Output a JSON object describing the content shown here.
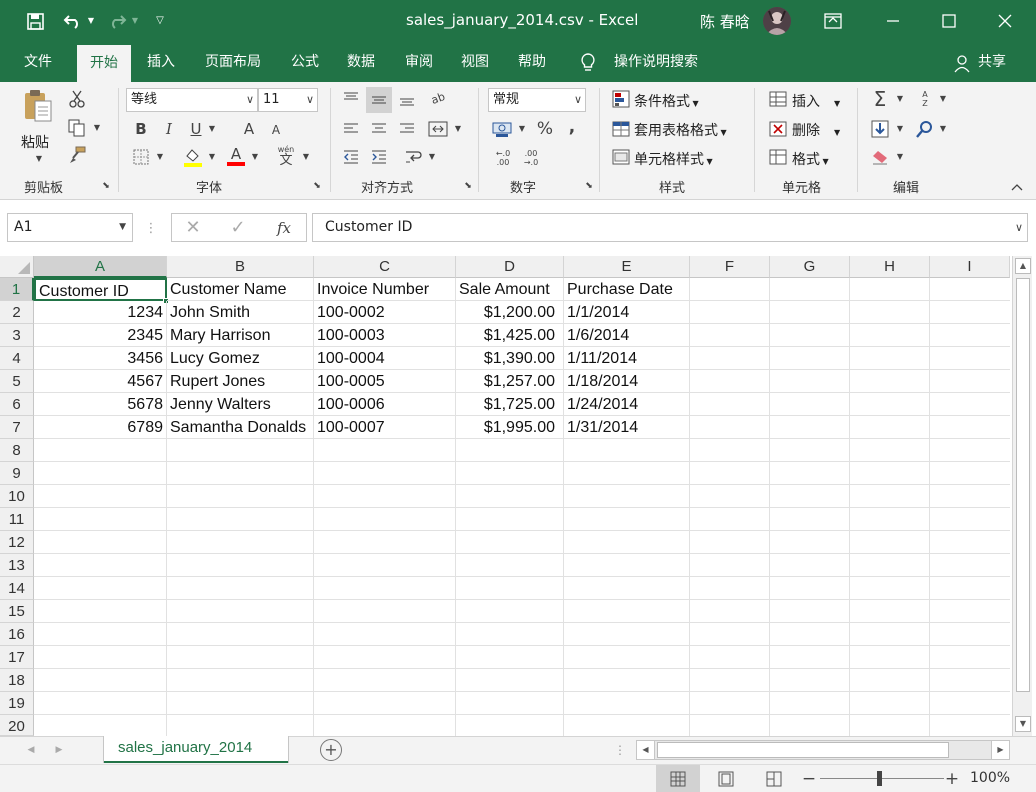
{
  "title_bar": {
    "doc_title": "sales_january_2014.csv",
    "separator": " - ",
    "app_name": "Excel",
    "user_name": "陈 春晗"
  },
  "ribbon_tabs": [
    "文件",
    "开始",
    "插入",
    "页面布局",
    "公式",
    "数据",
    "审阅",
    "视图",
    "帮助"
  ],
  "active_tab": "开始",
  "tell_me": "操作说明搜索",
  "share_label": "共享",
  "clipboard": {
    "paste_label": "粘贴",
    "group_label": "剪贴板"
  },
  "font": {
    "name": "等线",
    "size": "11",
    "bold": "B",
    "italic": "I",
    "underline": "U",
    "grow": "A",
    "shrink": "A",
    "phonetic": "wén",
    "phonetic_char": "文",
    "font_color_letter": "A",
    "highlight_color": "#ffff00",
    "font_color": "#ff0000",
    "group_label": "字体"
  },
  "alignment": {
    "group_label": "对齐方式",
    "orientation": "ab"
  },
  "number": {
    "format": "常规",
    "percent": "%",
    "comma": ",",
    "inc_decimal": "←.0\n.00",
    "dec_decimal": ".00\n→.0",
    "group_label": "数字"
  },
  "styles": {
    "conditional": "条件格式",
    "table": "套用表格格式",
    "cell_styles": "单元格样式",
    "group_label": "样式"
  },
  "cells": {
    "insert": "插入",
    "delete": "删除",
    "format": "格式",
    "group_label": "单元格"
  },
  "editing": {
    "sum": "Σ",
    "sort": "A Z",
    "group_label": "编辑"
  },
  "formula_bar": {
    "name_box": "A1",
    "fx": "fx",
    "content": "Customer ID"
  },
  "columns": [
    "A",
    "B",
    "C",
    "D",
    "E",
    "F",
    "G",
    "H",
    "I"
  ],
  "rows": [
    "1",
    "2",
    "3",
    "4",
    "5",
    "6",
    "7",
    "8",
    "9",
    "10",
    "11",
    "12",
    "13",
    "14",
    "15",
    "16",
    "17",
    "18",
    "19",
    "20"
  ],
  "table": {
    "headers": [
      "Customer ID",
      "Customer Name",
      "Invoice Number",
      "Sale Amount",
      "Purchase Date"
    ],
    "records": [
      [
        "1234",
        "John Smith",
        "100-0002",
        "$1,200.00",
        "1/1/2014"
      ],
      [
        "2345",
        "Mary Harrison",
        "100-0003",
        "$1,425.00",
        "1/6/2014"
      ],
      [
        "3456",
        "Lucy Gomez",
        "100-0004",
        "$1,390.00",
        "1/11/2014"
      ],
      [
        "4567",
        "Rupert Jones",
        "100-0005",
        "$1,257.00",
        "1/18/2014"
      ],
      [
        "5678",
        "Jenny Walters",
        "100-0006",
        "$1,725.00",
        "1/24/2014"
      ],
      [
        "6789",
        "Samantha Donalds",
        "100-0007",
        "$1,995.00",
        "1/31/2014"
      ]
    ]
  },
  "sheet_tabs": [
    "sales_january_2014"
  ],
  "status": {
    "zoom": "100%",
    "minus": "−",
    "plus": "+"
  },
  "colors": {
    "excel_green": "#217346",
    "ribbon_bg": "#f3f3f3"
  }
}
